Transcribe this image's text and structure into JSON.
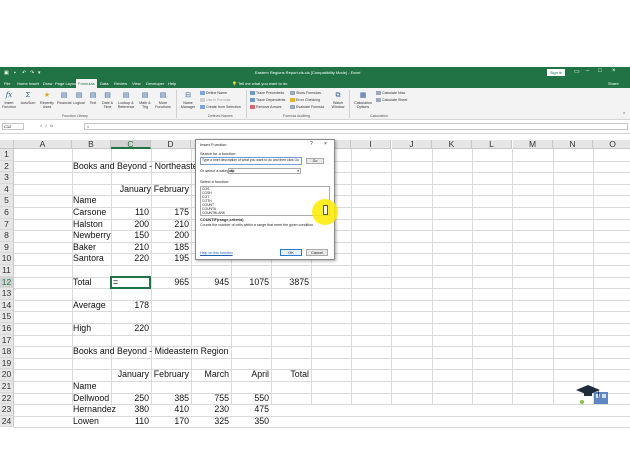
{
  "window": {
    "title": "Eastern Regions Report.xls.xls  [Compatibility Mode]  -  Excel",
    "sign_in": "Sign in"
  },
  "tabs": [
    "File",
    "Home",
    "Insert",
    "Draw",
    "Page Layout",
    "Formulas",
    "Data",
    "Review",
    "View",
    "Developer",
    "Help"
  ],
  "active_tab": "Formulas",
  "tell_me": "Tell me what you want to do",
  "share": "Share",
  "ribbon": {
    "function_library": {
      "label": "Function Library",
      "buttons": [
        "Insert Function",
        "AutoSum",
        "Recently Used",
        "Financial",
        "Logical",
        "Text",
        "Date & Time",
        "Lookup & Reference",
        "Math & Trig",
        "More Functions"
      ]
    },
    "defined_names": {
      "label": "Defined Names",
      "name_manager": "Name Manager",
      "define_name": "Define Name",
      "use_in_formula": "Use in Formula",
      "create_from_selection": "Create from Selection"
    },
    "formula_auditing": {
      "label": "Formula Auditing",
      "trace_precedents": "Trace Precedents",
      "trace_dependents": "Trace Dependents",
      "remove_arrows": "Remove Arrows",
      "show_formulas": "Show Formulas",
      "error_checking": "Error Checking",
      "evaluate_formula": "Evaluate Formula",
      "watch_window": "Watch Window"
    },
    "calculation": {
      "label": "Calculation",
      "calculation_options": "Calculation Options",
      "calculate_now": "Calculate Now",
      "calculate_sheet": "Calculate Sheet"
    }
  },
  "formula_bar": {
    "name_box": "C12",
    "formula": "="
  },
  "columns": [
    "A",
    "B",
    "C",
    "D",
    "E",
    "F",
    "G",
    "H",
    "I",
    "J",
    "K",
    "L",
    "M",
    "N",
    "O"
  ],
  "selected_column": "C",
  "rows": [
    "1",
    "2",
    "3",
    "4",
    "5",
    "6",
    "7",
    "8",
    "9",
    "10",
    "11",
    "12",
    "13",
    "14",
    "15",
    "16",
    "17",
    "18",
    "19",
    "20",
    "21",
    "22",
    "23",
    "24"
  ],
  "selected_row": "12",
  "cells": {
    "title1": "Books and Beyond - Northeastern",
    "hdr_january": "January",
    "hdr_february": "February",
    "hdr_name": "Name",
    "n_carsone": "Carsone",
    "n_halston": "Halston",
    "n_newberry": "Newberry",
    "n_baker": "Baker",
    "n_santora": "Santora",
    "c6": "110",
    "c7": "200",
    "c8": "150",
    "c9": "210",
    "c10": "220",
    "d6": "175",
    "d7": "210",
    "d8": "200",
    "d9": "185",
    "d10": "195",
    "total": "Total",
    "c12": "=",
    "d12": "965",
    "e12": "945",
    "f12": "1075",
    "g12": "3875",
    "average": "Average",
    "c14": "178",
    "high": "High",
    "c16": "220",
    "title2": "Books and Beyond - Mideastern Region",
    "h20_january": "January",
    "h20_february": "February",
    "h20_march": "March",
    "h20_april": "April",
    "h20_total": "Total",
    "h21_name": "Name",
    "n_dellwood": "Dellwood",
    "n_hernandez": "Hernandez",
    "n_lowen": "Lowen",
    "c22": "250",
    "d22": "385",
    "e22": "755",
    "f22": "550",
    "c23": "380",
    "d23": "410",
    "e23": "230",
    "f23": "475",
    "c24": "110",
    "d24": "170",
    "e24": "325",
    "f24": "350"
  },
  "dialog": {
    "title": "Insert Function",
    "help_btn": "?",
    "close_btn": "×",
    "search_label": "Search for a function:",
    "search_text": "Type a brief description of what you want to do and then click Go",
    "go": "Go",
    "category_label": "Or select a category:",
    "category_value": "All",
    "select_label": "Select a function:",
    "functions": [
      "CONVERT",
      "CORREL",
      "COS",
      "COSH",
      "COT",
      "COTH",
      "COUNT",
      "COUNTA",
      "COUNTBLANK",
      "COUNTIF",
      "COUNTIFS",
      "COUPDAYBS",
      "COUPDAYS",
      "COUPDAYSNC",
      "COUPNCD",
      "COUPNUM",
      "COUPPCD",
      "COVAR",
      "COVARIANCE.P",
      "COVARIANCE.S",
      "CRITBINOM",
      "CSC",
      "CSCH",
      "CUBEKPIMEMBER",
      "CUBEMEMBER",
      "CUBEMEMBERPROPERTY",
      "CUBERANKEDMEMBER",
      "CUBESET",
      "CUBESETCOUNT",
      "CUBEVALUE",
      "CUMIPMT",
      "CUMPRINC",
      "DATE",
      "DATEDIF",
      "DATEVALUE",
      "DAVERAGE",
      "DAY",
      "DAYS",
      "DAYS360",
      "DB",
      "DBCS",
      "DCOUNT",
      "DCOUNTA",
      "DDB"
    ],
    "selected_function": "COUNTIF",
    "syntax": "COUNTIF(range,criteria)",
    "description": "Counts the number of cells within a range that meet the given condition.",
    "help_link": "Help on this function",
    "ok": "OK",
    "cancel": "Cancel"
  },
  "colors": {
    "excel_green": "#217346",
    "highlight": "#ffeb00"
  }
}
